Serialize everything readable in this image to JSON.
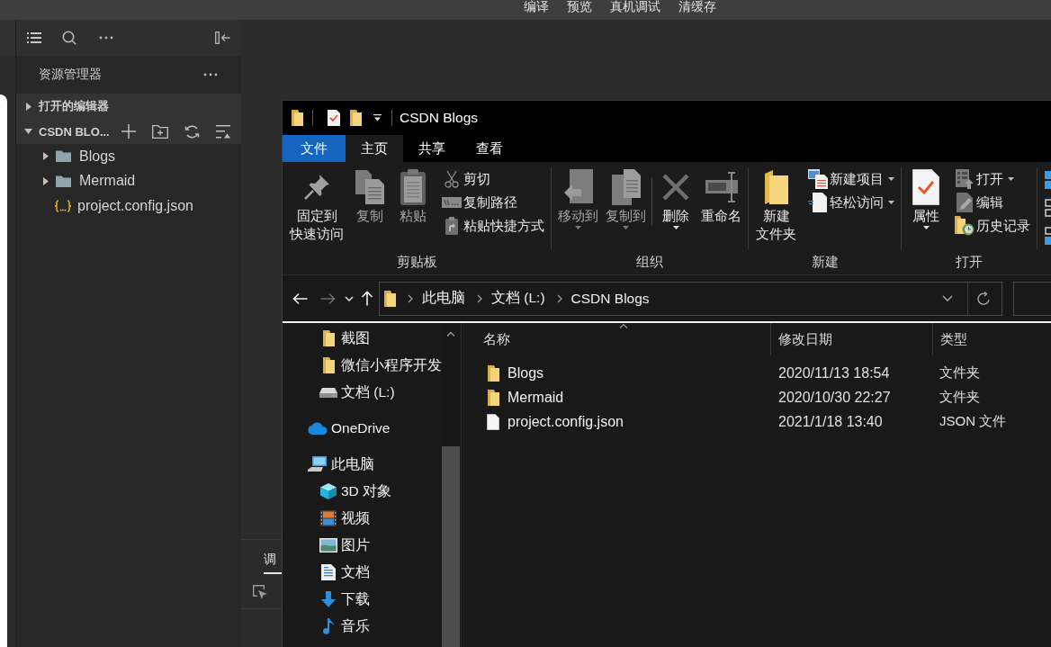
{
  "ide": {
    "toolbar_labels": [
      "编译",
      "预览",
      "真机调试",
      "清缓存"
    ],
    "sidebar": {
      "title": "资源管理器",
      "sections": [
        {
          "label": "打开的编辑器",
          "expanded": false
        },
        {
          "label": "CSDN BLO...",
          "expanded": true,
          "children": [
            {
              "name": "Blogs",
              "kind": "folder",
              "expanded": false
            },
            {
              "name": "Mermaid",
              "kind": "folder",
              "expanded": false
            },
            {
              "name": "project.config.json",
              "kind": "json"
            }
          ]
        }
      ]
    },
    "bottom_panel": {
      "tabs": [
        {
          "label": "调",
          "selected": true
        }
      ]
    }
  },
  "explorer": {
    "title": "CSDN Blogs",
    "ribbon_tabs": [
      {
        "label": "文件",
        "kind": "file",
        "selected": false
      },
      {
        "label": "主页",
        "kind": "tab",
        "selected": true
      },
      {
        "label": "共享",
        "kind": "tab",
        "selected": false
      },
      {
        "label": "查看",
        "kind": "tab",
        "selected": false
      }
    ],
    "ribbon_groups": [
      {
        "label": "剪贴板",
        "commands": [
          {
            "kind": "large",
            "label": "固定到快速访问",
            "disabled": false,
            "dropdown": false
          },
          {
            "kind": "large",
            "label": "复制",
            "disabled": true,
            "dropdown": false
          },
          {
            "kind": "large",
            "label": "粘贴",
            "disabled": true,
            "dropdown": false
          },
          {
            "kind": "small",
            "label": "剪切",
            "disabled": false,
            "dropdown": false
          },
          {
            "kind": "small",
            "label": "复制路径",
            "disabled": false,
            "dropdown": false
          },
          {
            "kind": "small",
            "label": "粘贴快捷方式",
            "disabled": false,
            "dropdown": false
          }
        ]
      },
      {
        "label": "组织",
        "commands": [
          {
            "kind": "large",
            "label": "移动到",
            "disabled": true,
            "dropdown": true
          },
          {
            "kind": "large",
            "label": "复制到",
            "disabled": true,
            "dropdown": true
          },
          {
            "kind": "separator"
          },
          {
            "kind": "large",
            "label": "删除",
            "disabled": false,
            "dropdown": true
          },
          {
            "kind": "large",
            "label": "重命名",
            "disabled": false,
            "dropdown": false
          }
        ]
      },
      {
        "label": "新建",
        "commands": [
          {
            "kind": "large",
            "label": "新建文件夹",
            "disabled": false,
            "dropdown": false
          },
          {
            "kind": "small",
            "label": "新建项目",
            "disabled": false,
            "dropdown": true
          },
          {
            "kind": "small",
            "label": "轻松访问",
            "disabled": false,
            "dropdown": true
          }
        ]
      },
      {
        "label": "打开",
        "commands": [
          {
            "kind": "large",
            "label": "属性",
            "disabled": false,
            "dropdown": true
          },
          {
            "kind": "small",
            "label": "打开",
            "disabled": false,
            "dropdown": true
          },
          {
            "kind": "small",
            "label": "编辑",
            "disabled": false,
            "dropdown": false
          },
          {
            "kind": "small",
            "label": "历史记录",
            "disabled": false,
            "dropdown": false
          }
        ]
      }
    ],
    "nav_buttons": [
      {
        "kind": "back",
        "disabled": false
      },
      {
        "kind": "forward",
        "disabled": true
      },
      {
        "kind": "recent",
        "disabled": false
      },
      {
        "kind": "up",
        "disabled": false
      }
    ],
    "breadcrumbs": [
      "此电脑",
      "文档 (L:)",
      "CSDN Blogs"
    ],
    "nav_pane": {
      "scrolled_group_items": [
        {
          "label": "截图",
          "kind": "folder"
        },
        {
          "label": "微信小程序开发",
          "kind": "folder"
        },
        {
          "label": "文档 (L:)",
          "kind": "drive"
        }
      ],
      "items": [
        {
          "label": "OneDrive",
          "kind": "cloud"
        },
        {
          "label": "此电脑",
          "kind": "pc",
          "children": [
            {
              "label": "3D 对象",
              "kind": "cube"
            },
            {
              "label": "视频",
              "kind": "video"
            },
            {
              "label": "图片",
              "kind": "picture"
            },
            {
              "label": "文档",
              "kind": "document"
            },
            {
              "label": "下载",
              "kind": "download"
            },
            {
              "label": "音乐",
              "kind": "music"
            }
          ]
        }
      ]
    },
    "columns": [
      {
        "label": "名称",
        "sorted": true
      },
      {
        "label": "修改日期",
        "sorted": false
      },
      {
        "label": "类型",
        "sorted": false
      }
    ],
    "files": [
      {
        "name": "Blogs",
        "kind": "folder",
        "modified": "2020/11/13 18:54",
        "type": "文件夹"
      },
      {
        "name": "Mermaid",
        "kind": "folder",
        "modified": "2020/10/30 22:27",
        "type": "文件夹"
      },
      {
        "name": "project.config.json",
        "kind": "file",
        "modified": "2021/1/18 13:40",
        "type": "JSON 文件"
      }
    ]
  }
}
